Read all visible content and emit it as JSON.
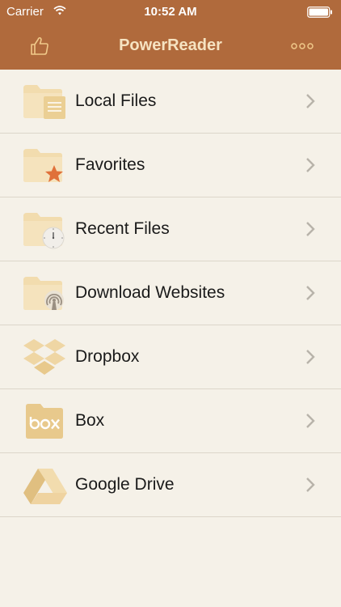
{
  "status_bar": {
    "carrier": "Carrier",
    "time": "10:52 AM"
  },
  "nav": {
    "title": "PowerReader",
    "left_icon": "thumbs-up-icon",
    "right_icon": "more-icon"
  },
  "colors": {
    "header": "#b06a3c",
    "title": "#f6e3c1",
    "background": "#f5f1e8",
    "folder": "#f2dcae",
    "accent": "#e0713a"
  },
  "items": [
    {
      "label": "Local Files",
      "icon": "local-files-folder-icon"
    },
    {
      "label": "Favorites",
      "icon": "favorites-folder-icon"
    },
    {
      "label": "Recent Files",
      "icon": "recent-files-folder-icon"
    },
    {
      "label": "Download Websites",
      "icon": "download-websites-folder-icon"
    },
    {
      "label": "Dropbox",
      "icon": "dropbox-icon"
    },
    {
      "label": "Box",
      "icon": "box-icon"
    },
    {
      "label": "Google Drive",
      "icon": "google-drive-icon"
    }
  ]
}
